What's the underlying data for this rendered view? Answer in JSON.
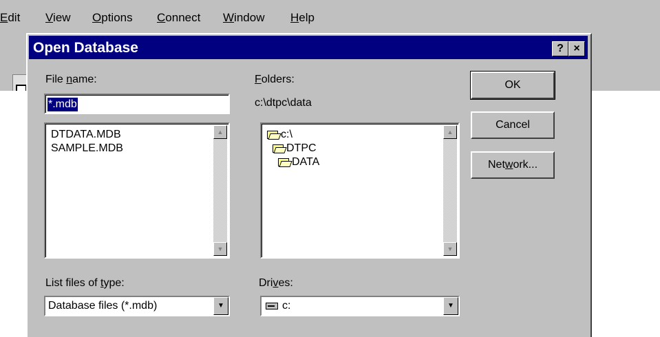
{
  "menubar": {
    "items": [
      {
        "label": "Edit",
        "mnemonic": "E",
        "rest": "dit"
      },
      {
        "label": "View",
        "mnemonic": "V",
        "rest": "iew"
      },
      {
        "label": "Options",
        "mnemonic": "O",
        "rest": "ptions"
      },
      {
        "label": "Connect",
        "mnemonic": "C",
        "rest": "onnect"
      },
      {
        "label": "Window",
        "mnemonic": "W",
        "rest": "indow"
      },
      {
        "label": "Help",
        "mnemonic": "H",
        "rest": "elp"
      }
    ]
  },
  "dialog": {
    "title": "Open Database",
    "help_button": "?",
    "close_button": "×",
    "file_name": {
      "label_pre": "File ",
      "label_mnemonic": "n",
      "label_post": "ame:",
      "value": "*.mdb"
    },
    "files": [
      "DTDATA.MDB",
      "SAMPLE.MDB"
    ],
    "folders": {
      "label_mnemonic": "F",
      "label_post": "olders:",
      "current_path": "c:\\dtpc\\data",
      "tree": [
        {
          "name": "c:\\",
          "state": "open"
        },
        {
          "name": "DTPC",
          "state": "open"
        },
        {
          "name": "DATA",
          "state": "open-selected"
        }
      ]
    },
    "file_type": {
      "label_pre": "List files of ",
      "label_mnemonic": "t",
      "label_post": "ype:",
      "value": "Database files (*.mdb)"
    },
    "drives": {
      "label_pre": "Dri",
      "label_mnemonic": "v",
      "label_post": "es:",
      "value": "c:"
    },
    "buttons": {
      "ok": "OK",
      "cancel": "Cancel",
      "network_pre": "Net",
      "network_mnemonic": "w",
      "network_post": "ork..."
    }
  },
  "colors": {
    "titlebar": "#000080",
    "face": "#c0c0c0",
    "selection": "#000080"
  },
  "icons": {
    "toolbar": "page-icon",
    "folder": "folder-icon",
    "drive": "hard-drive-icon",
    "scroll_up": "scroll-up-arrow-icon",
    "scroll_down": "scroll-down-arrow-icon",
    "dropdown": "dropdown-arrow-icon"
  }
}
